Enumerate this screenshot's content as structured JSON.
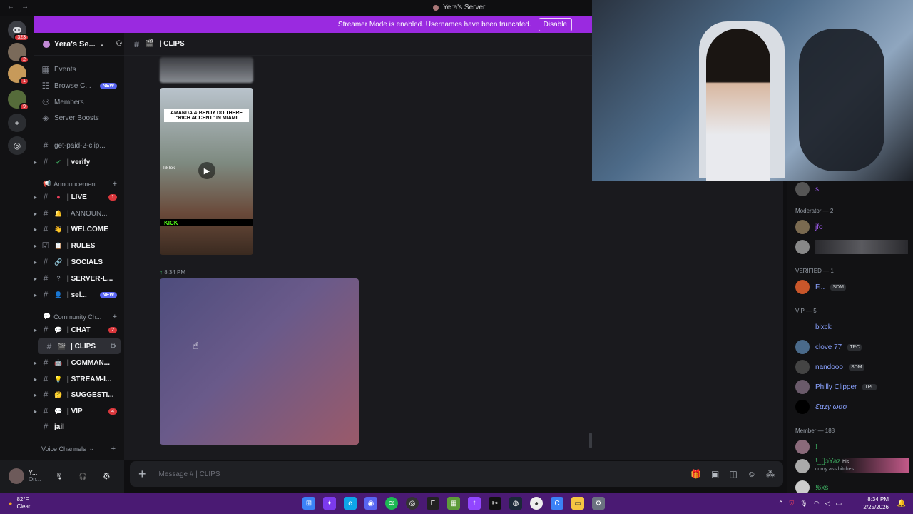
{
  "window": {
    "title": "Yera's Server"
  },
  "streamer_banner": {
    "text": "Streamer Mode is enabled. Usernames have been truncated.",
    "button": "Disable"
  },
  "guilds": {
    "dm_badge": "323",
    "badges": [
      "2",
      "1",
      "9"
    ]
  },
  "server": {
    "name": "Yera's Se..."
  },
  "sidebar": {
    "top_items": [
      "Events",
      "Browse C...",
      "Members",
      "Server Boosts"
    ],
    "new_label": "NEW",
    "channels_top": [
      "get-paid-2-clip...",
      "| verify"
    ],
    "category_1": "Announcement...",
    "channels_1": [
      {
        "label": "| LIVE",
        "badge": "1"
      },
      {
        "label": "| ANNOUN...",
        "badge": ""
      },
      {
        "label": "| WELCOME",
        "badge": ""
      },
      {
        "label": "| RULES",
        "badge": ""
      },
      {
        "label": "| SOCIALS",
        "badge": ""
      },
      {
        "label": "| SERVER-L...",
        "badge": ""
      },
      {
        "label": "| sel...",
        "badge": "NEW"
      }
    ],
    "category_2": "Community Ch...",
    "channels_2": [
      {
        "label": "| CHAT",
        "badge": "2"
      },
      {
        "label": "| CLIPS",
        "badge": ""
      },
      {
        "label": "| COMMAN...",
        "badge": ""
      },
      {
        "label": "| STREAM-I...",
        "badge": ""
      },
      {
        "label": "| SUGGESTI...",
        "badge": ""
      },
      {
        "label": "| VIP",
        "badge": "4"
      },
      {
        "label": "jail",
        "badge": ""
      }
    ],
    "voice_category": "Voice Channels"
  },
  "user_panel": {
    "name": "Y...",
    "status": "On..."
  },
  "chat": {
    "channel": "| CLIPS",
    "timestamp": "8:34 PM",
    "video_caption": "AMANDA & BENJY DO THERE \"RICH ACCENT\" IN MIAMI",
    "video_brand": "KICK",
    "video_watermark": "TikTok"
  },
  "input": {
    "placeholder": "Message # | CLIPS"
  },
  "members": {
    "moderator_header": "Moderator — 2",
    "verified_header": "VERIFIED — 1",
    "vip_header": "VIP — 5",
    "member_header": "Member — 188",
    "top_name": "s",
    "mods": [
      "jfo"
    ],
    "verified": [
      {
        "name": "F...",
        "tag": "SDM"
      }
    ],
    "vip": [
      {
        "name": "blxck",
        "tag": "",
        "color": "#8aa2ff"
      },
      {
        "name": "clove 77",
        "tag": "TPC",
        "color": "#8aa2ff"
      },
      {
        "name": "nandooo",
        "tag": "SDM",
        "color": "#8aa2ff"
      },
      {
        "name": "Philly Clipper",
        "tag": "TPC",
        "color": "#8aa2ff"
      },
      {
        "name": "Ɛαzу ωσσ",
        "tag": "",
        "color": "#8aa2ff"
      }
    ],
    "member_list": [
      {
        "name": "!",
        "status": ""
      },
      {
        "name": "!_[]ɔYaz",
        "status": "corny ass bitches."
      },
      {
        "name": "!6xs",
        "status": ""
      }
    ],
    "member_extra": "his"
  },
  "taskbar": {
    "weather_temp": "82°F",
    "weather_desc": "Clear",
    "time": "8:34 PM",
    "date": "2/25/2026"
  },
  "colors": {
    "accent": "#5865f2",
    "streamer": "#9a2ae0",
    "taskbar": "#4a1a73"
  }
}
